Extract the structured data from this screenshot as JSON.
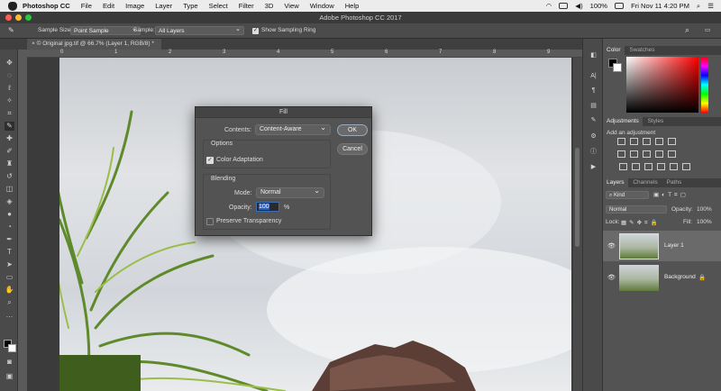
{
  "menubar": {
    "app": "Photoshop CC",
    "items": [
      "File",
      "Edit",
      "Image",
      "Layer",
      "Type",
      "Select",
      "Filter",
      "3D",
      "View",
      "Window",
      "Help"
    ],
    "battery": "100%",
    "clock": "Fri Nov 11  4:20 PM"
  },
  "window": {
    "title": "Adobe Photoshop CC 2017"
  },
  "options": {
    "sample_size_label": "Sample Size:",
    "sample_size_value": "Point Sample",
    "sample_label": "Sample:",
    "sample_value": "All Layers",
    "show_ring_label": "Show Sampling Ring"
  },
  "document": {
    "tab": "© Original jpg.tif @ 66.7% (Layer 1, RGB/8) *"
  },
  "ruler": {
    "ticks": [
      "0",
      "1",
      "2",
      "3",
      "4",
      "5",
      "6",
      "7",
      "8",
      "9"
    ]
  },
  "dialog": {
    "title": "Fill",
    "contents_label": "Contents:",
    "contents_value": "Content-Aware",
    "options_legend": "Options",
    "color_adaptation_label": "Color Adaptation",
    "blending_legend": "Blending",
    "mode_label": "Mode:",
    "mode_value": "Normal",
    "opacity_label": "Opacity:",
    "opacity_value": "100",
    "opacity_unit": "%",
    "preserve_label": "Preserve Transparency",
    "ok_label": "OK",
    "cancel_label": "Cancel"
  },
  "panels": {
    "color_tab": "Color",
    "swatches_tab": "Swatches",
    "adjustments_tab": "Adjustments",
    "styles_tab": "Styles",
    "add_adjustment": "Add an adjustment",
    "layers_tab": "Layers",
    "channels_tab": "Channels",
    "paths_tab": "Paths",
    "kind_label": "Kind",
    "blend_mode": "Normal",
    "opacity_label": "Opacity:",
    "opacity_value": "100%",
    "lock_label": "Lock:",
    "fill_label": "Fill:",
    "fill_value": "100%",
    "layers": [
      {
        "name": "Layer 1"
      },
      {
        "name": "Background"
      }
    ]
  }
}
